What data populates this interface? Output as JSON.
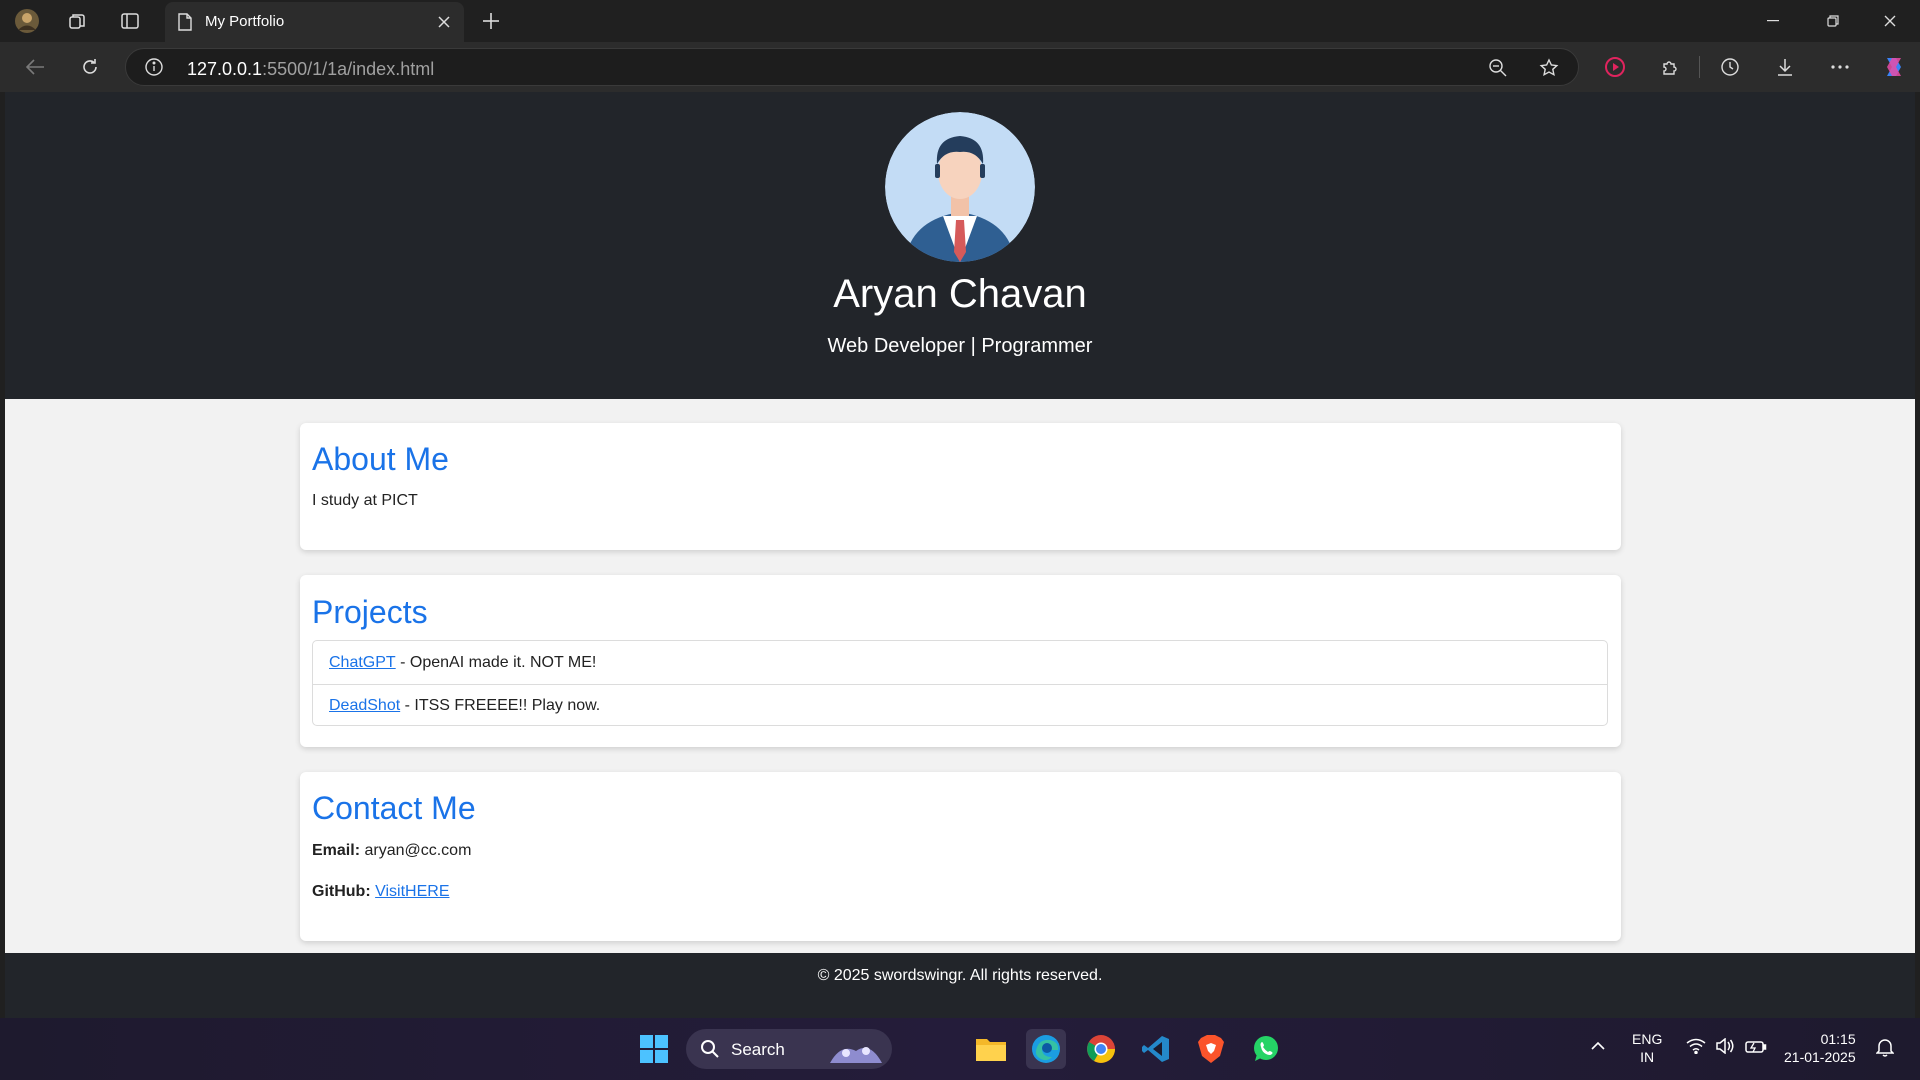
{
  "browser": {
    "tab_title": "My Portfolio",
    "url_host": "127.0.0.1",
    "url_path": ":5500/1/1a/index.html"
  },
  "page": {
    "name": "Aryan Chavan",
    "tagline": "Web Developer | Programmer",
    "about": {
      "heading": "About Me",
      "text": "I study at PICT"
    },
    "projects": {
      "heading": "Projects",
      "items": [
        {
          "link": "ChatGPT",
          "desc": " - OpenAI made it. NOT ME!"
        },
        {
          "link": "DeadShot",
          "desc": " - ITSS FREEEE!! Play now."
        }
      ]
    },
    "contact": {
      "heading": "Contact Me",
      "email_label": "Email:",
      "email_value": " aryan@cc.com",
      "github_label": "GitHub:",
      "github_link": "VisitHERE"
    },
    "footer": "© 2025 swordswingr. All rights reserved."
  },
  "taskbar": {
    "search_placeholder": "Search",
    "lang_line1": "ENG",
    "lang_line2": "IN",
    "time": "01:15",
    "date": "21-01-2025"
  },
  "colors": {
    "accent": "#1a73e8",
    "header_bg": "#22252a",
    "page_bg": "#f2f2f2"
  }
}
